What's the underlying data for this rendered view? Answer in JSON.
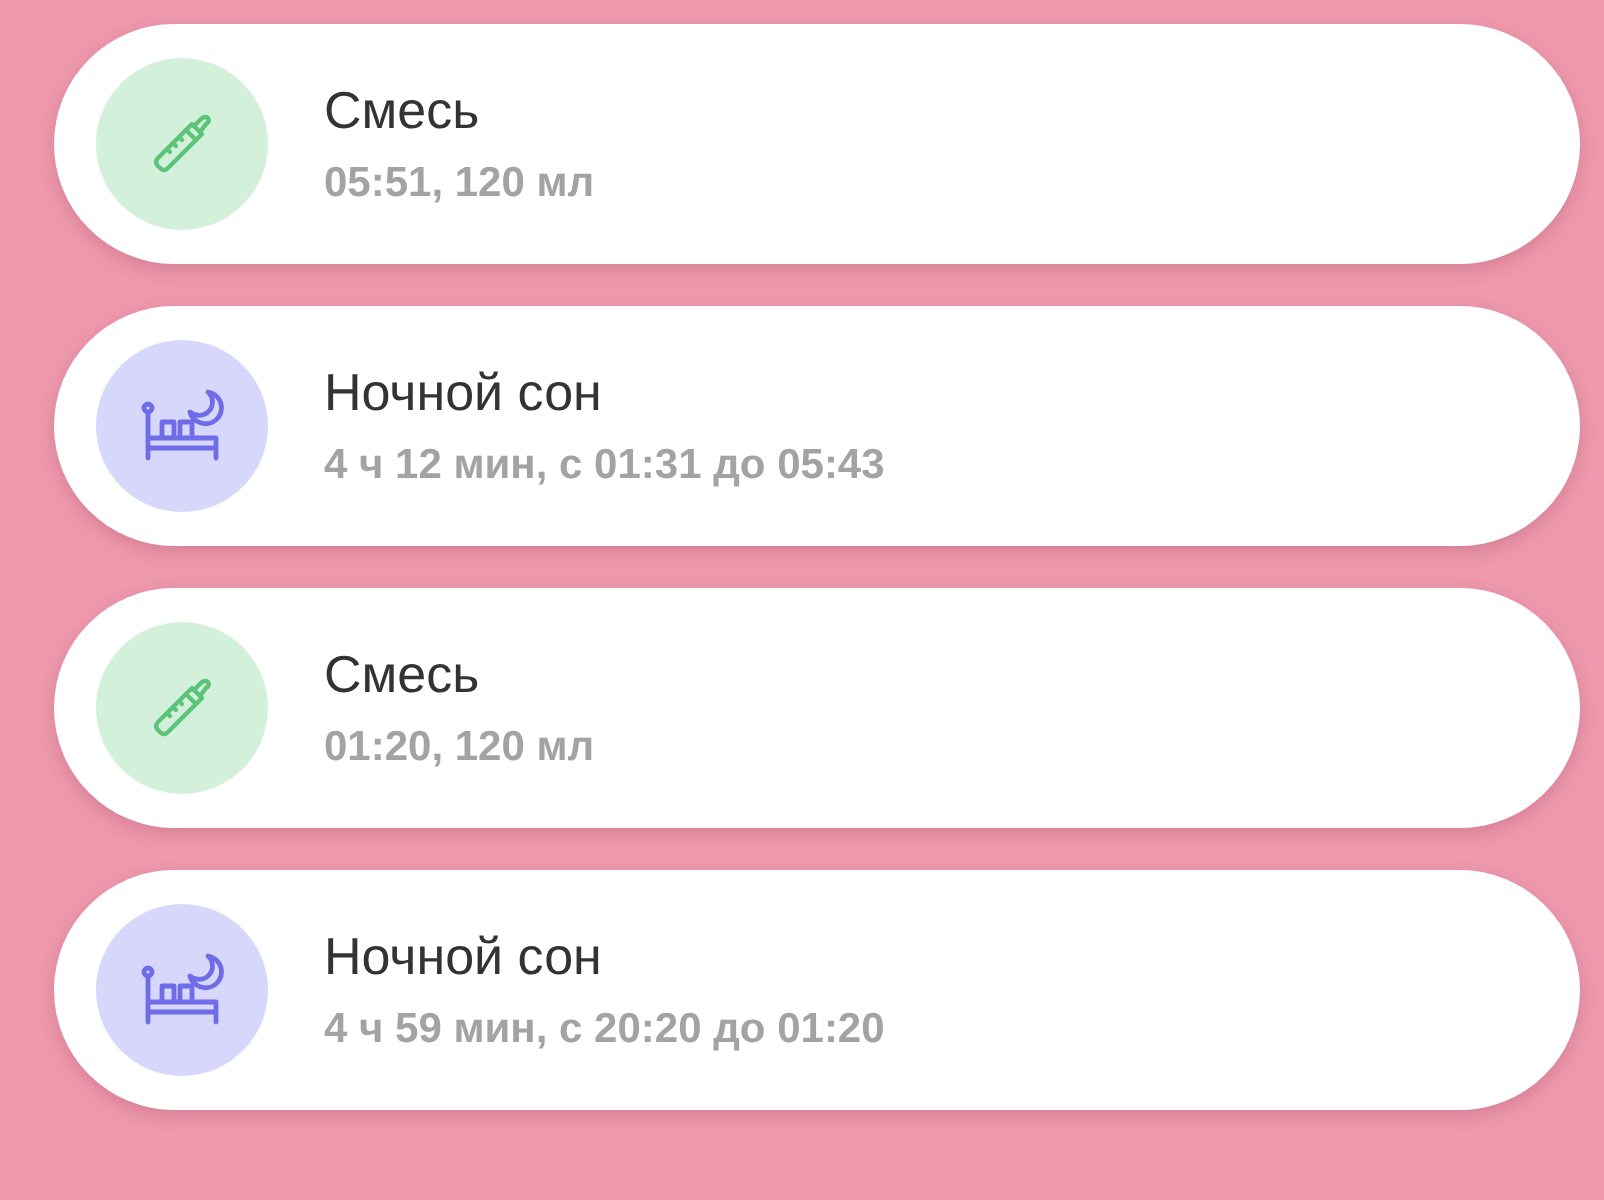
{
  "entries": [
    {
      "kind": "feeding",
      "title": "Смесь",
      "details": "05:51, 120 мл"
    },
    {
      "kind": "sleep",
      "title": "Ночной сон",
      "details": "4 ч 12 мин, с 01:31 до 05:43"
    },
    {
      "kind": "feeding",
      "title": "Смесь",
      "details": "01:20, 120 мл"
    },
    {
      "kind": "sleep",
      "title": "Ночной сон",
      "details": "4 ч 59 мин, с 20:20 до 01:20"
    }
  ]
}
